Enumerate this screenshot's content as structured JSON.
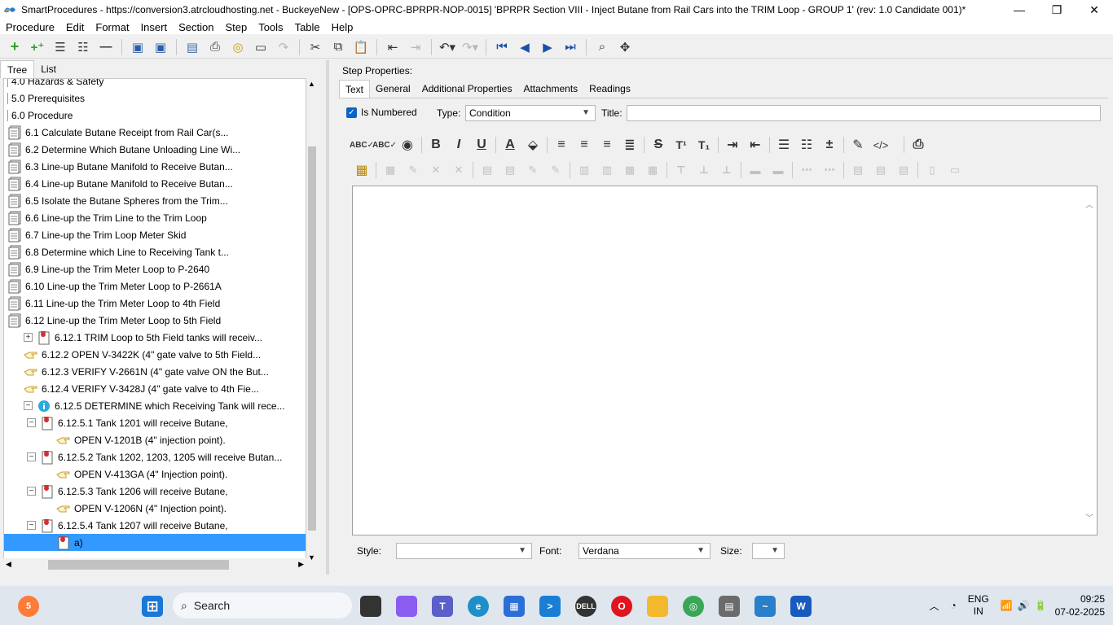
{
  "window": {
    "title": "SmartProcedures - https://conversion3.atrcloudhosting.net - BuckeyeNew - [OPS-OPRC-BPRPR-NOP-0015] 'BPRPR Section VIII - Inject Butane from Rail Cars into the TRIM Loop - GROUP 1' (rev: 1.0 Candidate 001)*",
    "minimize": "—",
    "restore": "❐",
    "close": "✕"
  },
  "menu": [
    "Procedure",
    "Edit",
    "Format",
    "Insert",
    "Section",
    "Step",
    "Tools",
    "Table",
    "Help"
  ],
  "left_tabs": {
    "tree": "Tree",
    "list": "List"
  },
  "tree": [
    {
      "label": "4.0 Hazards & Safety",
      "indent": 0,
      "icon": "none"
    },
    {
      "label": "5.0 Prerequisites",
      "indent": 0,
      "icon": "none"
    },
    {
      "label": "6.0 Procedure",
      "indent": 0,
      "icon": "none"
    },
    {
      "label": "6.1 Calculate Butane Receipt from Rail Car(s...",
      "indent": 1,
      "icon": "document"
    },
    {
      "label": "6.2 Determine Which Butane Unloading Line Wi...",
      "indent": 1,
      "icon": "document"
    },
    {
      "label": "6.3 Line-up Butane Manifold to Receive Butan...",
      "indent": 1,
      "icon": "document"
    },
    {
      "label": "6.4 Line-up Butane Manifold to Receive Butan...",
      "indent": 1,
      "icon": "document"
    },
    {
      "label": "6.5 Isolate the Butane Spheres from the Trim...",
      "indent": 1,
      "icon": "document"
    },
    {
      "label": "6.6 Line-up the Trim Line to the Trim Loop",
      "indent": 1,
      "icon": "document"
    },
    {
      "label": "6.7 Line-up the Trim Loop Meter Skid",
      "indent": 1,
      "icon": "document"
    },
    {
      "label": "6.8 Determine which Line to Receiving Tank t...",
      "indent": 1,
      "icon": "document"
    },
    {
      "label": "6.9 Line-up the Trim Meter Loop to P-2640",
      "indent": 1,
      "icon": "document"
    },
    {
      "label": "6.10 Line-up the Trim Meter Loop to P-2661A",
      "indent": 1,
      "icon": "document"
    },
    {
      "label": "6.11 Line-up the Trim Meter Loop to 4th Field",
      "indent": 1,
      "icon": "document"
    },
    {
      "label": "6.12 Line-up the Trim Meter Loop to 5th Field",
      "indent": 1,
      "icon": "document"
    },
    {
      "label": "6.12.1 TRIM Loop to 5th Field tanks will receiv...",
      "indent": 2,
      "icon": "condition",
      "expander": "+"
    },
    {
      "label": "6.12.2 OPEN V-3422K (4\" gate valve to 5th Field...",
      "indent": 2,
      "icon": "hand"
    },
    {
      "label": "6.12.3 VERIFY V-2661N (4\" gate valve ON the But...",
      "indent": 2,
      "icon": "hand"
    },
    {
      "label": "6.12.4 VERIFY V-3428J (4\" gate valve to 4th Fie...",
      "indent": 2,
      "icon": "hand"
    },
    {
      "label": "6.12.5 DETERMINE which Receiving Tank will rece...",
      "indent": 2,
      "icon": "info",
      "expander": "−"
    },
    {
      "label": "6.12.5.1 Tank 1201 will receive Butane,",
      "indent": 3,
      "icon": "condition",
      "expander": "−"
    },
    {
      "label": "OPEN V-1201B (4\" injection point).",
      "indent": 4,
      "icon": "hand"
    },
    {
      "label": "6.12.5.2 Tank 1202, 1203, 1205 will receive Butan...",
      "indent": 3,
      "icon": "condition",
      "expander": "−"
    },
    {
      "label": "OPEN V-413GA (4\" Injection point).",
      "indent": 4,
      "icon": "hand"
    },
    {
      "label": "6.12.5.3 Tank 1206 will receive Butane,",
      "indent": 3,
      "icon": "condition",
      "expander": "−"
    },
    {
      "label": "OPEN V-1206N (4\" Injection point).",
      "indent": 4,
      "icon": "hand"
    },
    {
      "label": "6.12.5.4 Tank 1207 will receive Butane,",
      "indent": 3,
      "icon": "condition",
      "expander": "−"
    },
    {
      "label": "a)",
      "indent": 4,
      "icon": "condition",
      "selected": true
    }
  ],
  "right": {
    "step_properties": "Step Properties:",
    "tabs": [
      "Text",
      "General",
      "Additional Properties",
      "Attachments",
      "Readings"
    ],
    "is_numbered_label": "Is Numbered",
    "type_label": "Type:",
    "type_value": "Condition",
    "title_label": "Title:",
    "title_value": "",
    "style_label": "Style:",
    "style_value": "",
    "font_label": "Font:",
    "font_value": "Verdana",
    "size_label": "Size:",
    "size_value": ""
  },
  "format_buttons": {
    "bold": "B",
    "italic": "I",
    "underline": "U",
    "strike": "S",
    "superscript": "T¹",
    "subscript": "T₁",
    "source": "</>"
  },
  "taskbar": {
    "search": "Search",
    "lang_top": "ENG",
    "lang_bottom": "IN",
    "time": "09:25",
    "date": "07-02-2025",
    "badge": "5"
  },
  "colors": {
    "selection": "#3399ff",
    "accent": "#0a64c8",
    "condition_icon": "#d32f2f",
    "info_icon": "#29a9e0",
    "hand_icon": "#c8a030"
  }
}
